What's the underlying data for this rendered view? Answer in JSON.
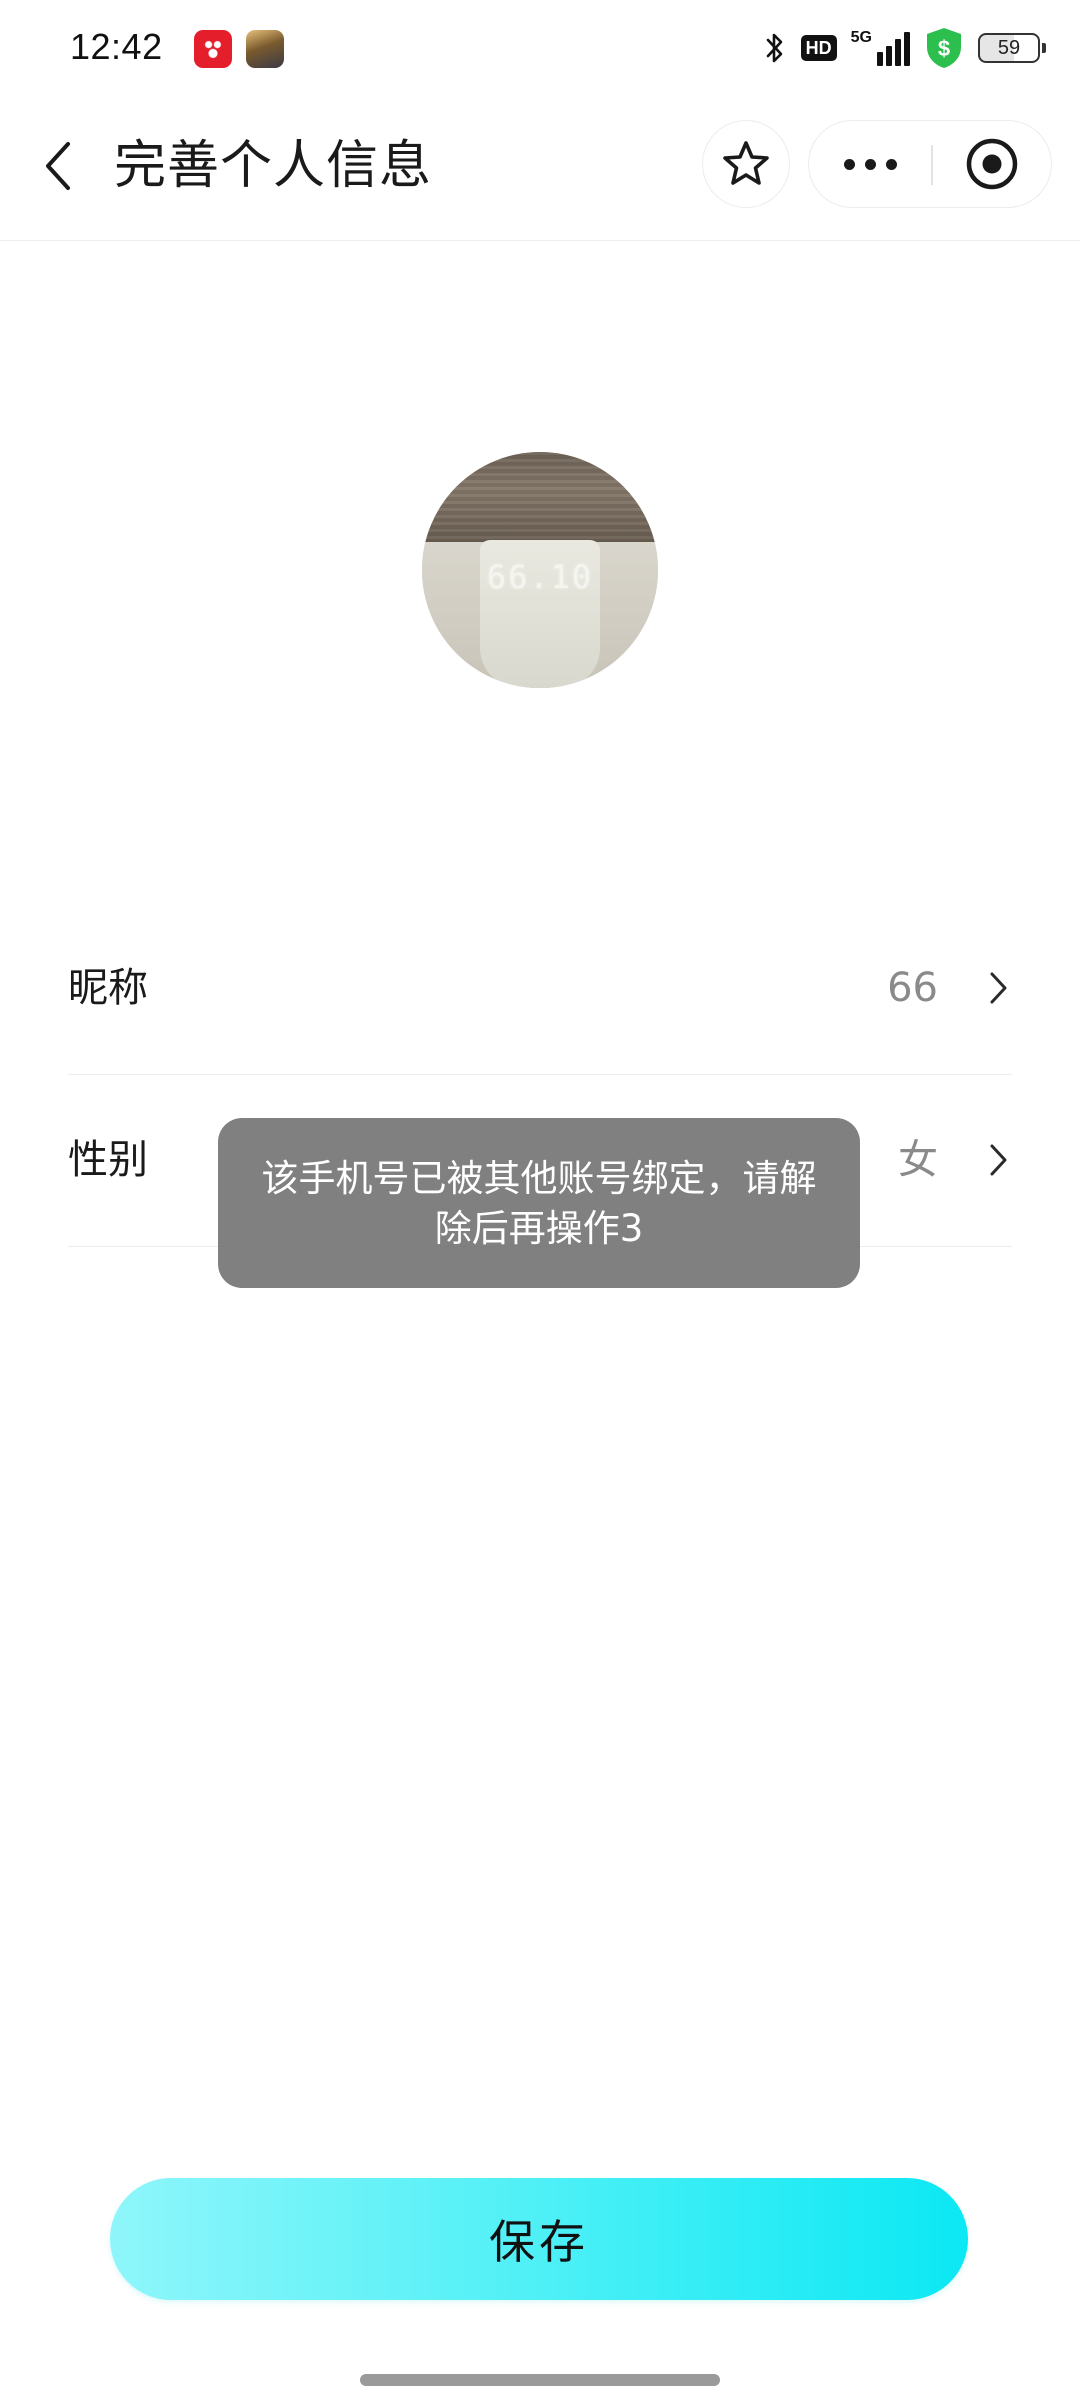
{
  "status_bar": {
    "time": "12:42",
    "hd_label": "HD",
    "network": "5G",
    "battery": "59",
    "app_icons": [
      "pinduoduo-icon",
      "game-icon"
    ]
  },
  "nav": {
    "title": "完善个人信息"
  },
  "avatar": {
    "readout": "66.10"
  },
  "form": {
    "nickname": {
      "label": "昵称",
      "value": "66"
    },
    "gender": {
      "label": "性别",
      "value": "女"
    }
  },
  "toast": {
    "message": "该手机号已被其他账号绑定，请解除后再操作3"
  },
  "actions": {
    "save_label": "保存"
  },
  "colors": {
    "accent_start": "#8ff6fb",
    "accent_end": "#0be8f4",
    "shield": "#2dbf4e",
    "toast_bg": "#6e6e6e"
  }
}
